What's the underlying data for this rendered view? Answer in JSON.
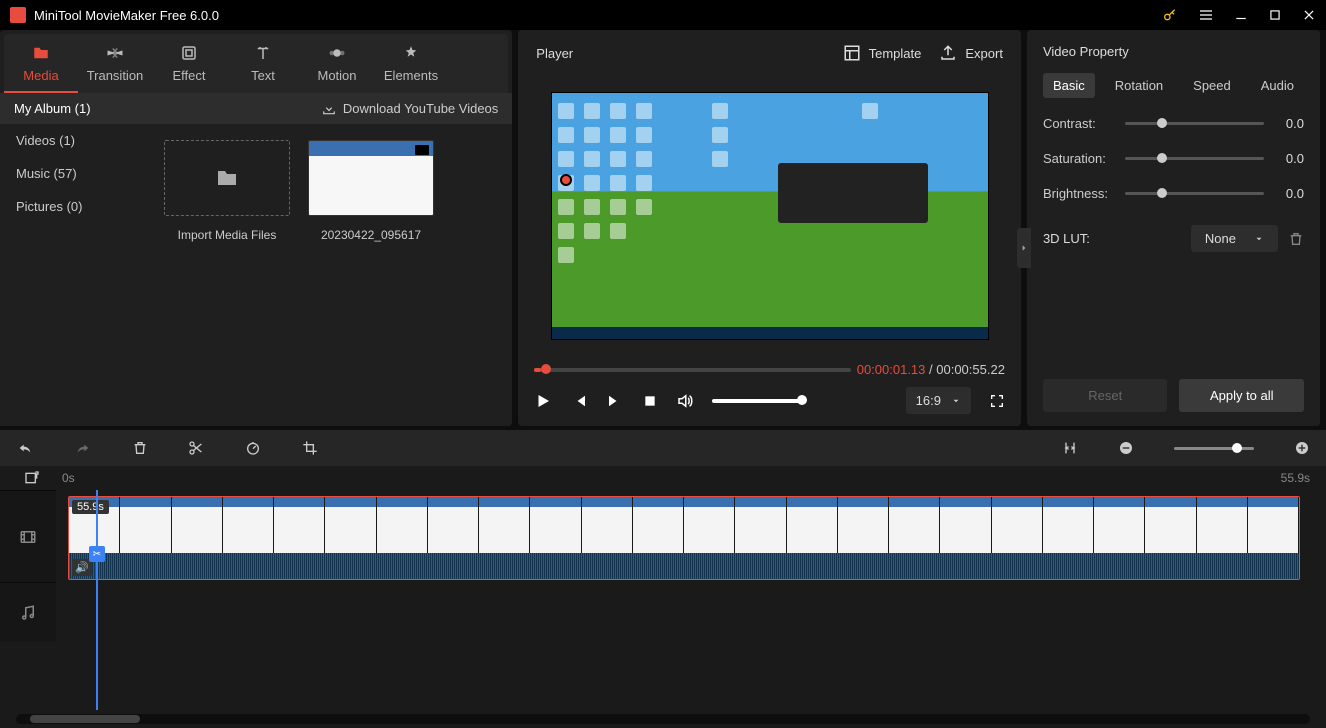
{
  "app": {
    "title": "MiniTool MovieMaker Free 6.0.0"
  },
  "tabs": {
    "media": "Media",
    "transition": "Transition",
    "effect": "Effect",
    "text": "Text",
    "motion": "Motion",
    "elements": "Elements",
    "active": "media"
  },
  "sidebar": {
    "header": "My Album (1)",
    "download_label": "Download YouTube Videos",
    "items": [
      "Videos (1)",
      "Music (57)",
      "Pictures (0)"
    ]
  },
  "media": {
    "import_label": "Import Media Files",
    "clip_name": "20230422_095617"
  },
  "player": {
    "title": "Player",
    "template_label": "Template",
    "export_label": "Export",
    "current_time": "00:00:01.13",
    "sep": " / ",
    "total_time": "00:00:55.22",
    "aspect": "16:9"
  },
  "props": {
    "title": "Video Property",
    "tabs": {
      "basic": "Basic",
      "rotation": "Rotation",
      "speed": "Speed",
      "audio": "Audio"
    },
    "contrast_label": "Contrast:",
    "contrast_value": "0.0",
    "saturation_label": "Saturation:",
    "saturation_value": "0.0",
    "brightness_label": "Brightness:",
    "brightness_value": "0.0",
    "lut_label": "3D LUT:",
    "lut_value": "None",
    "reset_label": "Reset",
    "apply_label": "Apply to all"
  },
  "timeline": {
    "start": "0s",
    "end": "55.9s",
    "clip_duration": "55.9s"
  }
}
